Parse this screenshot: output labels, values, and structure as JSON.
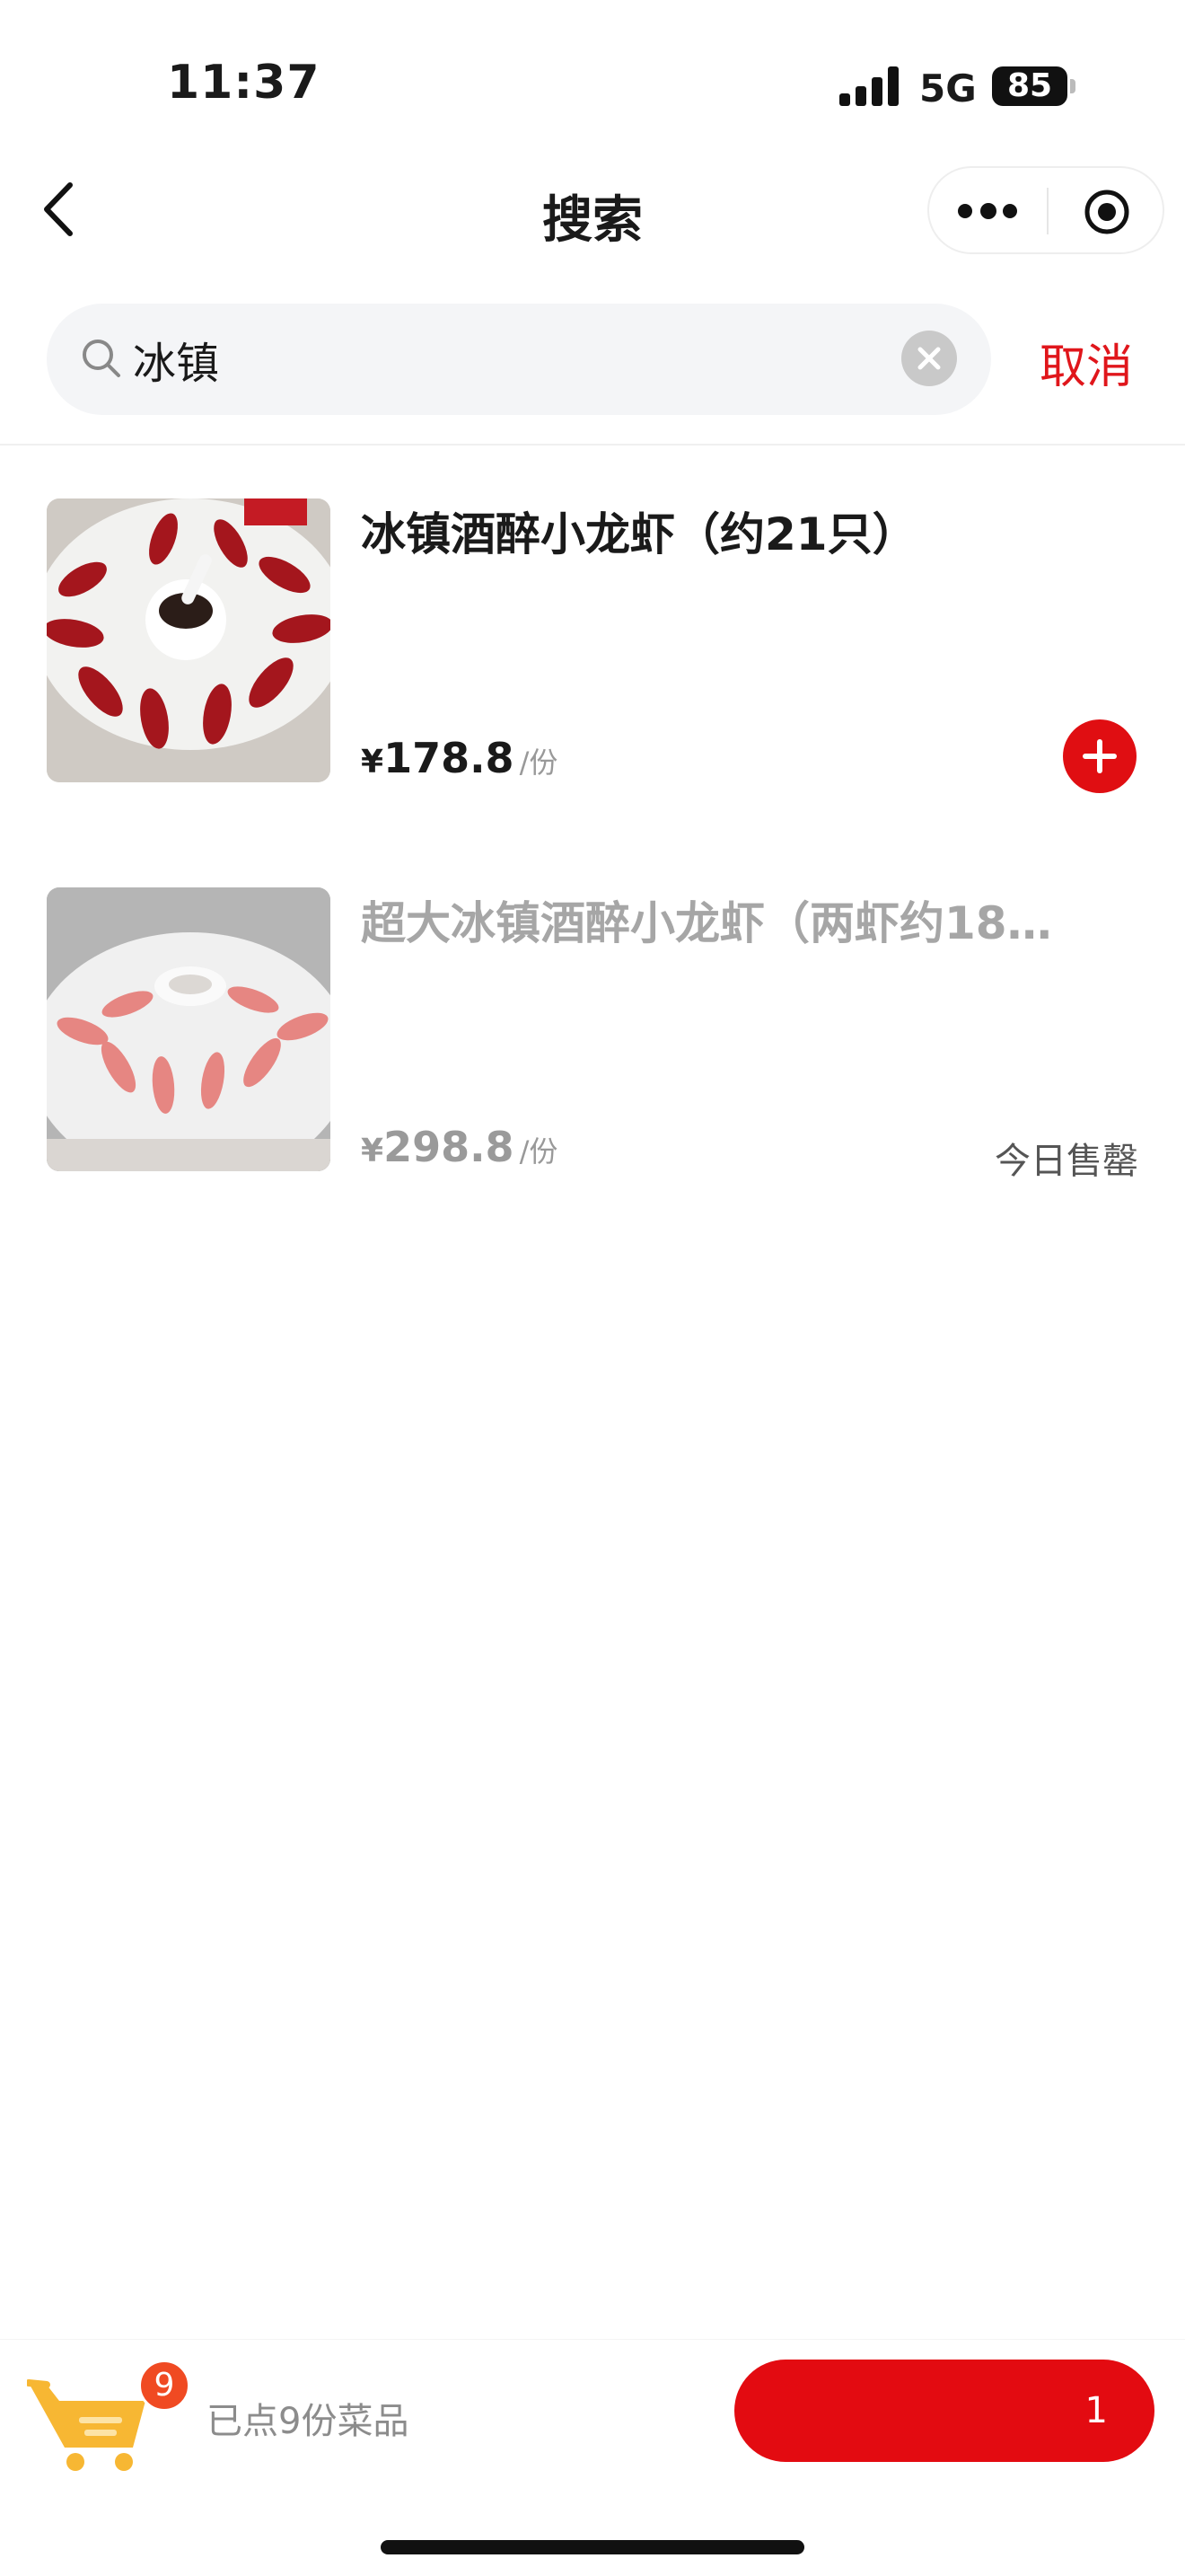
{
  "status_bar": {
    "time": "11:37",
    "network": "5G",
    "battery": "85"
  },
  "nav": {
    "title": "搜索",
    "icons": [
      "back-arrow-icon",
      "more-dots-icon",
      "target-icon"
    ]
  },
  "search": {
    "value": "冰镇",
    "cancel_label": "取消",
    "icons": [
      "search-icon",
      "clear-icon"
    ]
  },
  "results": [
    {
      "name": "冰镇酒醉小龙虾（约21只）",
      "currency": "¥",
      "price": "178.8",
      "unit": "/份",
      "available": true
    },
    {
      "name": "超大冰镇酒醉小龙虾（两虾约18…",
      "currency": "¥",
      "price": "298.8",
      "unit": "/份",
      "available": false,
      "status": "今日售罄"
    }
  ],
  "cart": {
    "count": "9",
    "summary": "已点9份菜品",
    "checkout_label": "1"
  },
  "colors": {
    "accent": "#e00e12",
    "badge": "#f04a22",
    "cart_icon": "#f7b733"
  }
}
